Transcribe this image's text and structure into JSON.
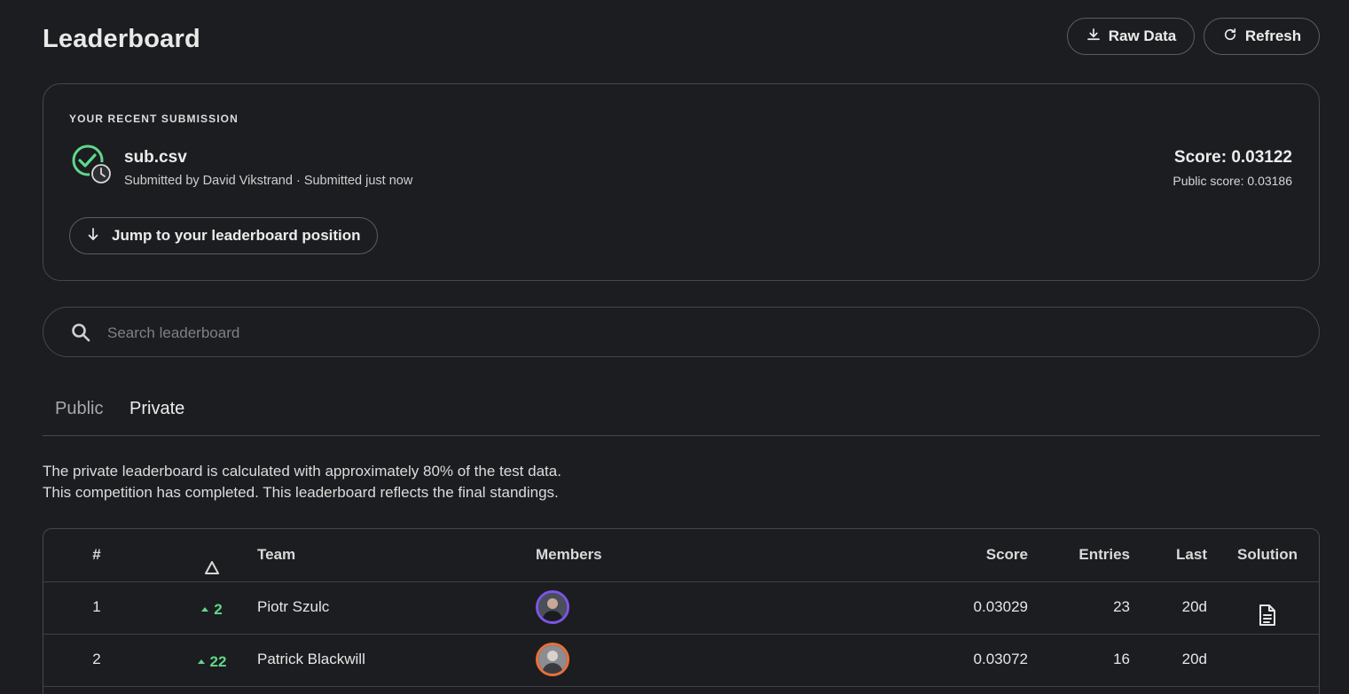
{
  "header": {
    "title": "Leaderboard",
    "raw_data_label": "Raw Data",
    "refresh_label": "Refresh"
  },
  "submission": {
    "heading": "YOUR RECENT SUBMISSION",
    "file_name": "sub.csv",
    "meta": "Submitted by David Vikstrand · Submitted just now",
    "score": "Score: 0.03122",
    "public_score": "Public score: 0.03186",
    "jump_label": "Jump to your leaderboard position"
  },
  "search": {
    "placeholder": "Search leaderboard"
  },
  "tabs": [
    {
      "label": "Public",
      "active": false
    },
    {
      "label": "Private",
      "active": true
    }
  ],
  "note": {
    "line1": "The private leaderboard is calculated with approximately 80% of the test data.",
    "line2": "This competition has completed. This leaderboard reflects the final standings."
  },
  "table": {
    "columns": {
      "rank": "#",
      "delta_icon": "delta-icon",
      "team": "Team",
      "members": "Members",
      "score": "Score",
      "entries": "Entries",
      "last": "Last",
      "solution": "Solution"
    },
    "rows": [
      {
        "rank": "1",
        "delta": "2",
        "team": "Piotr Szulc",
        "avatar_ring": "#7b56e8",
        "score": "0.03029",
        "entries": "23",
        "last": "20d",
        "has_solution": true
      },
      {
        "rank": "2",
        "delta": "22",
        "team": "Patrick Blackwill",
        "avatar_ring": "#e8713a",
        "score": "0.03072",
        "entries": "16",
        "last": "20d",
        "has_solution": false
      }
    ]
  },
  "colors": {
    "background": "#1c1d20",
    "border": "#46474a",
    "positive": "#5fd88a",
    "success_check": "#5fd88a"
  }
}
